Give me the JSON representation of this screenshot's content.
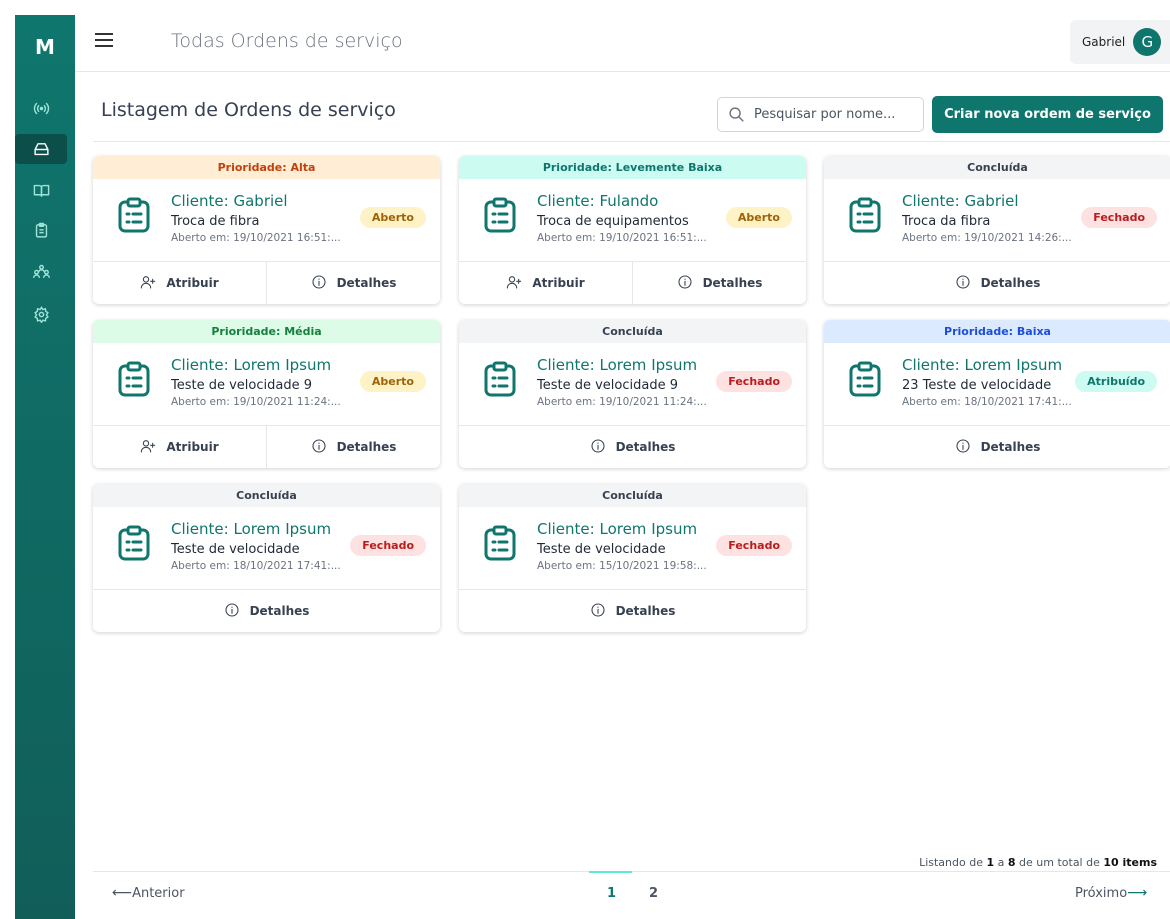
{
  "app": {
    "logo": "M",
    "title": "Todas Ordens de serviço",
    "user": {
      "name": "Gabriel",
      "initial": "G"
    }
  },
  "sidebar": {
    "items": [
      {
        "icon": "broadcast-icon",
        "active": false
      },
      {
        "icon": "inbox-icon",
        "active": true
      },
      {
        "icon": "book-icon",
        "active": false
      },
      {
        "icon": "clipboard-icon",
        "active": false
      },
      {
        "icon": "users-icon",
        "active": false
      },
      {
        "icon": "gear-icon",
        "active": false
      }
    ]
  },
  "header": {
    "title": "Listagem de Ordens de serviço",
    "search_placeholder": "Pesquisar por nome...",
    "create_label": "Criar nova ordem de serviço"
  },
  "labels": {
    "assign": "Atribuir",
    "details": "Detalhes"
  },
  "colors": {
    "primary": "#0f766e",
    "sidebar": "#0f766e"
  },
  "orders": [
    {
      "header": "Prioridade: Alta",
      "header_bg": "#ffedd5",
      "header_color": "#c2410c",
      "client": "Cliente: Gabriel",
      "service": "Troca de fibra",
      "opened": "Aberto em: 19/10/2021 16:51:...",
      "status": "Aberto",
      "status_bg": "#fef3c7",
      "status_color": "#a16207",
      "can_assign": true
    },
    {
      "header": "Prioridade: Levemente Baixa",
      "header_bg": "#ccfbf1",
      "header_color": "#0f766e",
      "client": "Cliente: Fulando",
      "service": "Troca de equipamentos",
      "opened": "Aberto em: 19/10/2021 16:51:...",
      "status": "Aberto",
      "status_bg": "#fef3c7",
      "status_color": "#a16207",
      "can_assign": true
    },
    {
      "header": "Concluída",
      "header_bg": "#f3f4f6",
      "header_color": "#374151",
      "client": "Cliente: Gabriel",
      "service": "Troca da fibra",
      "opened": "Aberto em: 19/10/2021 14:26:...",
      "status": "Fechado",
      "status_bg": "#fee2e2",
      "status_color": "#b91c1c",
      "can_assign": false
    },
    {
      "header": "Prioridade: Média",
      "header_bg": "#dcfce7",
      "header_color": "#15803d",
      "client": "Cliente: Lorem Ipsum",
      "service": "Teste de velocidade 9",
      "opened": "Aberto em: 19/10/2021 11:24:...",
      "status": "Aberto",
      "status_bg": "#fef3c7",
      "status_color": "#a16207",
      "can_assign": true
    },
    {
      "header": "Concluída",
      "header_bg": "#f3f4f6",
      "header_color": "#374151",
      "client": "Cliente: Lorem Ipsum",
      "service": "Teste de velocidade 9",
      "opened": "Aberto em: 19/10/2021 11:24:...",
      "status": "Fechado",
      "status_bg": "#fee2e2",
      "status_color": "#b91c1c",
      "can_assign": false
    },
    {
      "header": "Prioridade: Baixa",
      "header_bg": "#dbeafe",
      "header_color": "#1d4ed8",
      "client": "Cliente: Lorem Ipsum",
      "service": "23 Teste de velocidade",
      "opened": "Aberto em: 18/10/2021 17:41:...",
      "status": "Atribuído",
      "status_bg": "#ccfbf1",
      "status_color": "#0f766e",
      "can_assign": false
    },
    {
      "header": "Concluída",
      "header_bg": "#f3f4f6",
      "header_color": "#374151",
      "client": "Cliente: Lorem Ipsum",
      "service": "Teste de velocidade",
      "opened": "Aberto em: 18/10/2021 17:41:...",
      "status": "Fechado",
      "status_bg": "#fee2e2",
      "status_color": "#b91c1c",
      "can_assign": false
    },
    {
      "header": "Concluída",
      "header_bg": "#f3f4f6",
      "header_color": "#374151",
      "client": "Cliente: Lorem Ipsum",
      "service": "Teste de velocidade",
      "opened": "Aberto em: 15/10/2021 19:58:...",
      "status": "Fechado",
      "status_bg": "#fee2e2",
      "status_color": "#b91c1c",
      "can_assign": false
    }
  ],
  "pagination": {
    "summary_prefix": "Listando de ",
    "from": "1",
    "summary_mid1": " a ",
    "to": "8",
    "summary_mid2": " de um total de ",
    "total": "10 items",
    "prev_arrow": "⟵",
    "prev": "Anterior",
    "next": "Próximo",
    "next_arrow": "⟶",
    "pages": [
      "1",
      "2"
    ],
    "current": "1"
  }
}
